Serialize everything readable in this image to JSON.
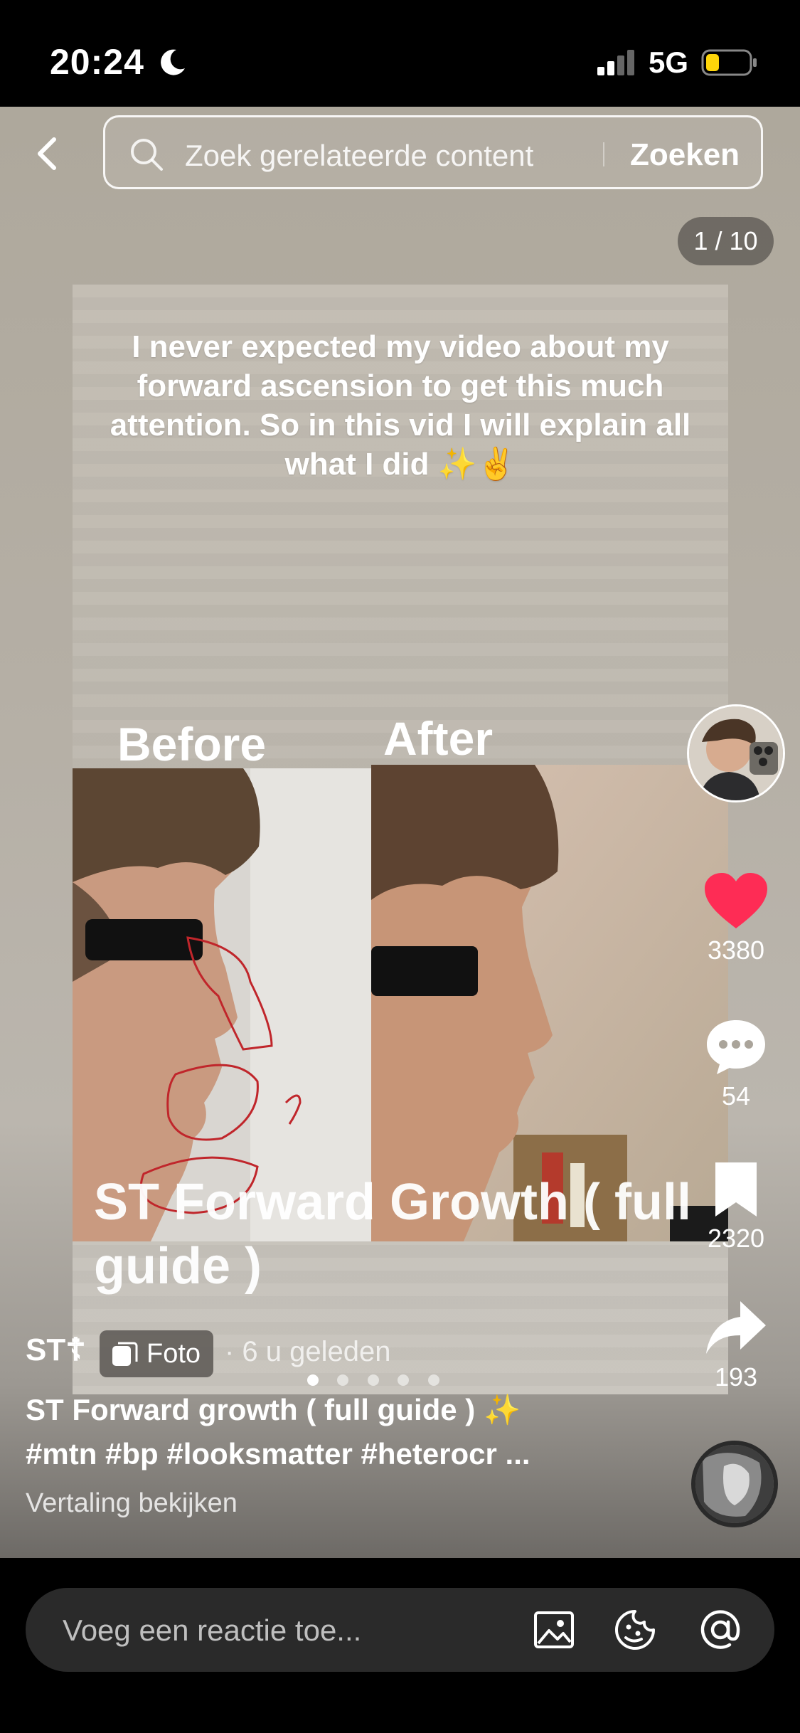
{
  "status_bar": {
    "time": "20:24",
    "network": "5G"
  },
  "search": {
    "placeholder": "Zoek gerelateerde content",
    "submit_label": "Zoeken"
  },
  "page_counter": "1 / 10",
  "slide": {
    "intro_text": "I never expected my video about my forward ascension  to get this much attention. So in this vid I will explain all what I did ✨✌️",
    "label_before": "Before",
    "label_after": "After",
    "overlay_title": "ST Forward Growth ( full guide )"
  },
  "carousel": {
    "total_dots": 5,
    "active_index": 0
  },
  "actions": {
    "likes": "3380",
    "comments": "54",
    "saves": "2320",
    "shares": "193"
  },
  "post": {
    "author": "ST☦",
    "badge": "Foto",
    "time": "· 6 u geleden",
    "caption": "ST Forward growth ( full guide ) ✨",
    "tags": "#mtn #bp #looksmatter #heterocr ...",
    "translate": "Vertaling bekijken"
  },
  "comment": {
    "placeholder": "Voeg een reactie toe..."
  },
  "colors": {
    "like": "#fe2c55",
    "background": "#000000"
  }
}
